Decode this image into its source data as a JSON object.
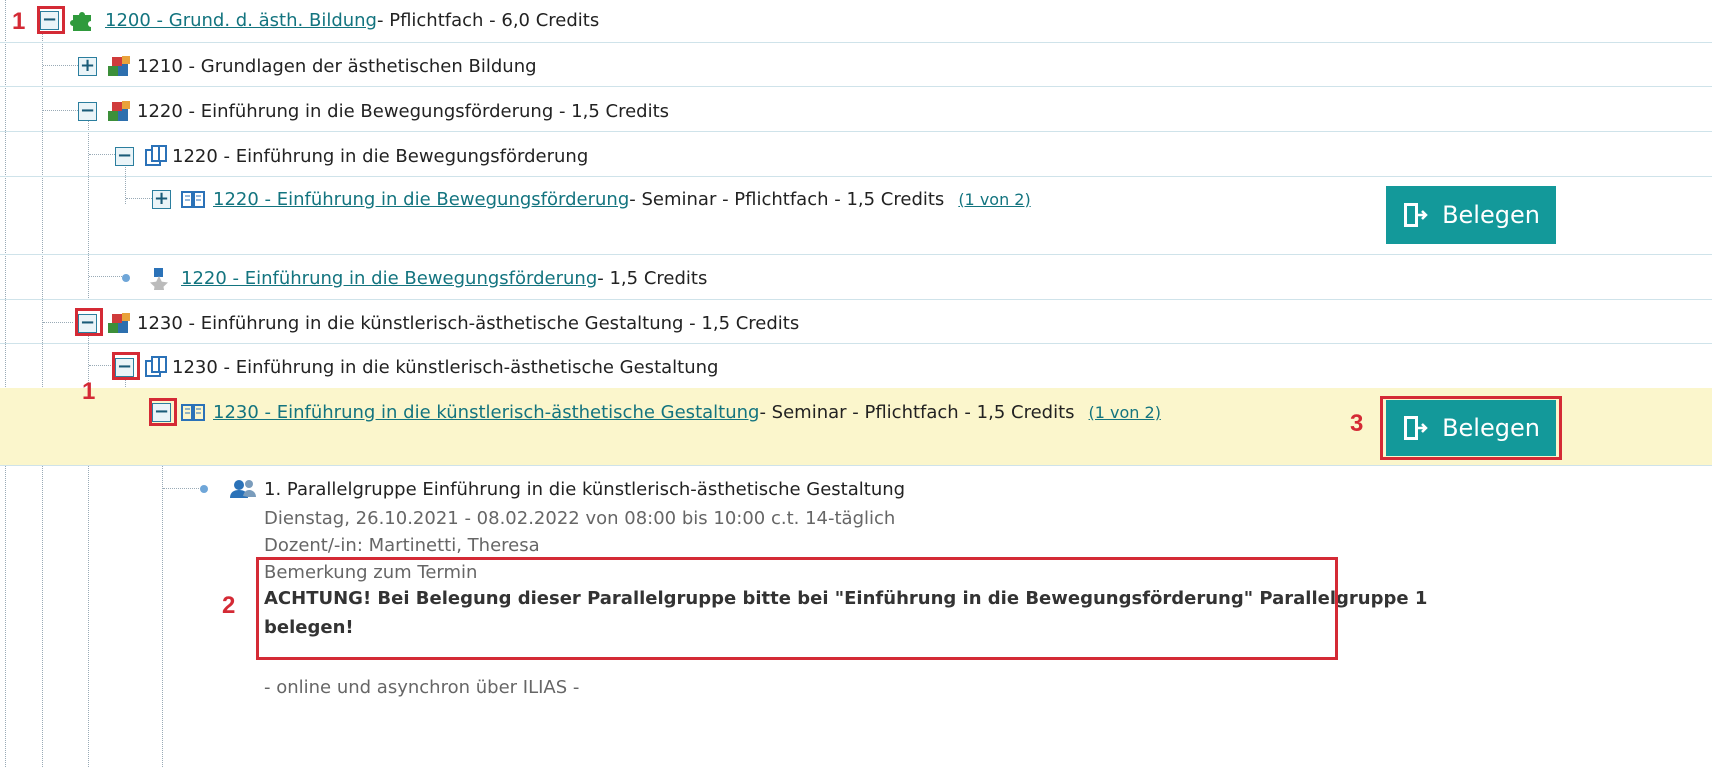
{
  "tree": {
    "r1": {
      "link": "1200 - Grund. d. ästh. Bildung",
      "suffix": " - Pflichtfach - 6,0 Credits"
    },
    "r2": {
      "text": "1210 - Grundlagen der ästhetischen Bildung"
    },
    "r3": {
      "text": "1220 - Einführung in die Bewegungsförderung - 1,5 Credits"
    },
    "r4": {
      "text": "1220 - Einführung in die Bewegungsförderung"
    },
    "r5": {
      "link": "1220 - Einführung in die Bewegungsförderung",
      "suffix": " - Seminar - Pflichtfach - 1,5 Credits",
      "count": "(1 von 2)"
    },
    "r6": {
      "link": "1220 - Einführung in die Bewegungsförderung",
      "suffix": " - 1,5 Credits"
    },
    "r7": {
      "text": "1230 - Einführung in die künstlerisch-ästhetische Gestaltung - 1,5 Credits"
    },
    "r8": {
      "text": "1230 - Einführung in die künstlerisch-ästhetische Gestaltung"
    },
    "r9": {
      "link": "1230 - Einführung in die künstlerisch-ästhetische Gestaltung",
      "suffix": " - Seminar - Pflichtfach - 1,5 Credits",
      "count": "(1 von 2)"
    }
  },
  "group": {
    "title": "1. Parallelgruppe Einführung in die künstlerisch-ästhetische Gestaltung",
    "schedule": "Dienstag, 26.10.2021 - 08.02.2022 von 08:00 bis 10:00 c.t. 14-täglich",
    "lecturer": "Dozent/-in: Martinetti, Theresa",
    "note_label": "Bemerkung zum Termin",
    "note_line1": "ACHTUNG! Bei Belegung dieser Parallelgruppe bitte bei \"Einführung in die Bewegungsförderung\" Parallelgruppe 1",
    "note_line2": "belegen!",
    "extra": "- online und asynchron über ILIAS -"
  },
  "buttons": {
    "belegen_1": "Belegen",
    "belegen_2": "Belegen"
  },
  "annotations": {
    "label_1a": "1",
    "label_1b": "1",
    "label_2": "2",
    "label_3": "3"
  },
  "colors": {
    "accent": "#13999a",
    "link": "#13747f",
    "highlight": "#fbf6cc",
    "annotation": "#d42a35"
  }
}
